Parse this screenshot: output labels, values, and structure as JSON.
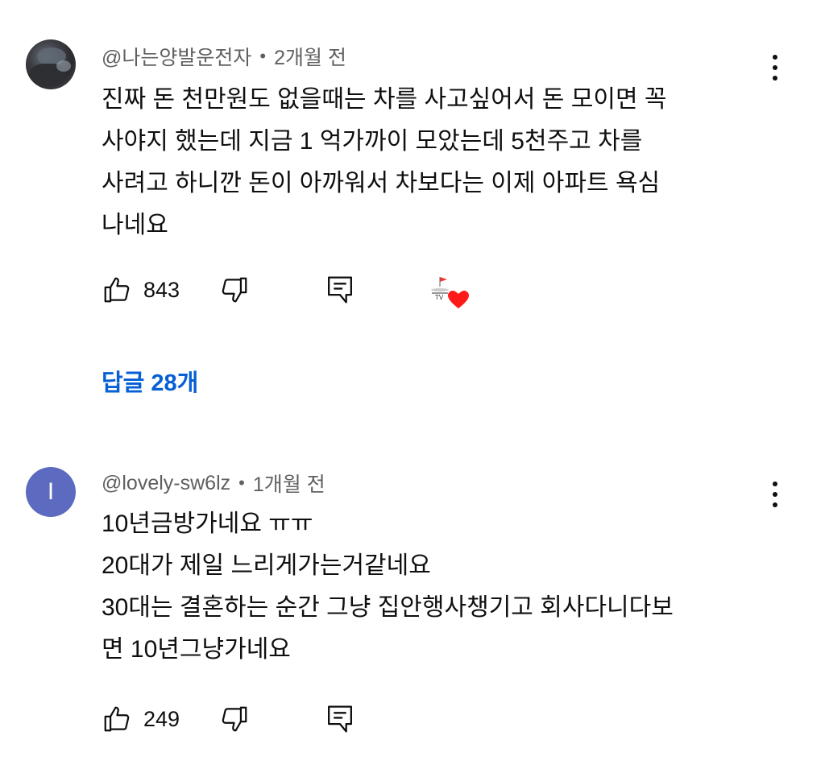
{
  "comments": [
    {
      "author": "@나는양발운전자",
      "separator": "•",
      "time": "2개월 전",
      "lines": [
        "진짜 돈 천만원도 없을때는 차를 사고싶어서  돈 모이면 꼭",
        "사야지  했는데  지금 1 억가까이 모았는데 5천주고 차를",
        "사려고 하니깐  돈이 아까워서  차보다는 이제 아파트 욕심",
        "나네요"
      ],
      "likes": "843",
      "creator_badge_text": "TV",
      "replies_label": "답글 28개"
    },
    {
      "author": "@lovely-sw6lz",
      "avatar_letter": "I",
      "separator": "•",
      "time": "1개월 전",
      "lines": [
        "10년금방가네요 ㅠㅠ",
        "20대가 제일 느리게가는거같네요",
        "30대는 결혼하는 순간 그냥 집안행사챙기고 회사다니다보",
        "면 10년그냥가네요"
      ],
      "likes": "249"
    }
  ],
  "colors": {
    "link": "#065fd4",
    "meta_text": "#606060",
    "avatar_bg": "#5c6bc0",
    "heart": "#ff1a1a"
  },
  "icons": [
    "thumbs-up-icon",
    "thumbs-down-icon",
    "reply-icon",
    "more-vert-icon",
    "heart-icon"
  ]
}
